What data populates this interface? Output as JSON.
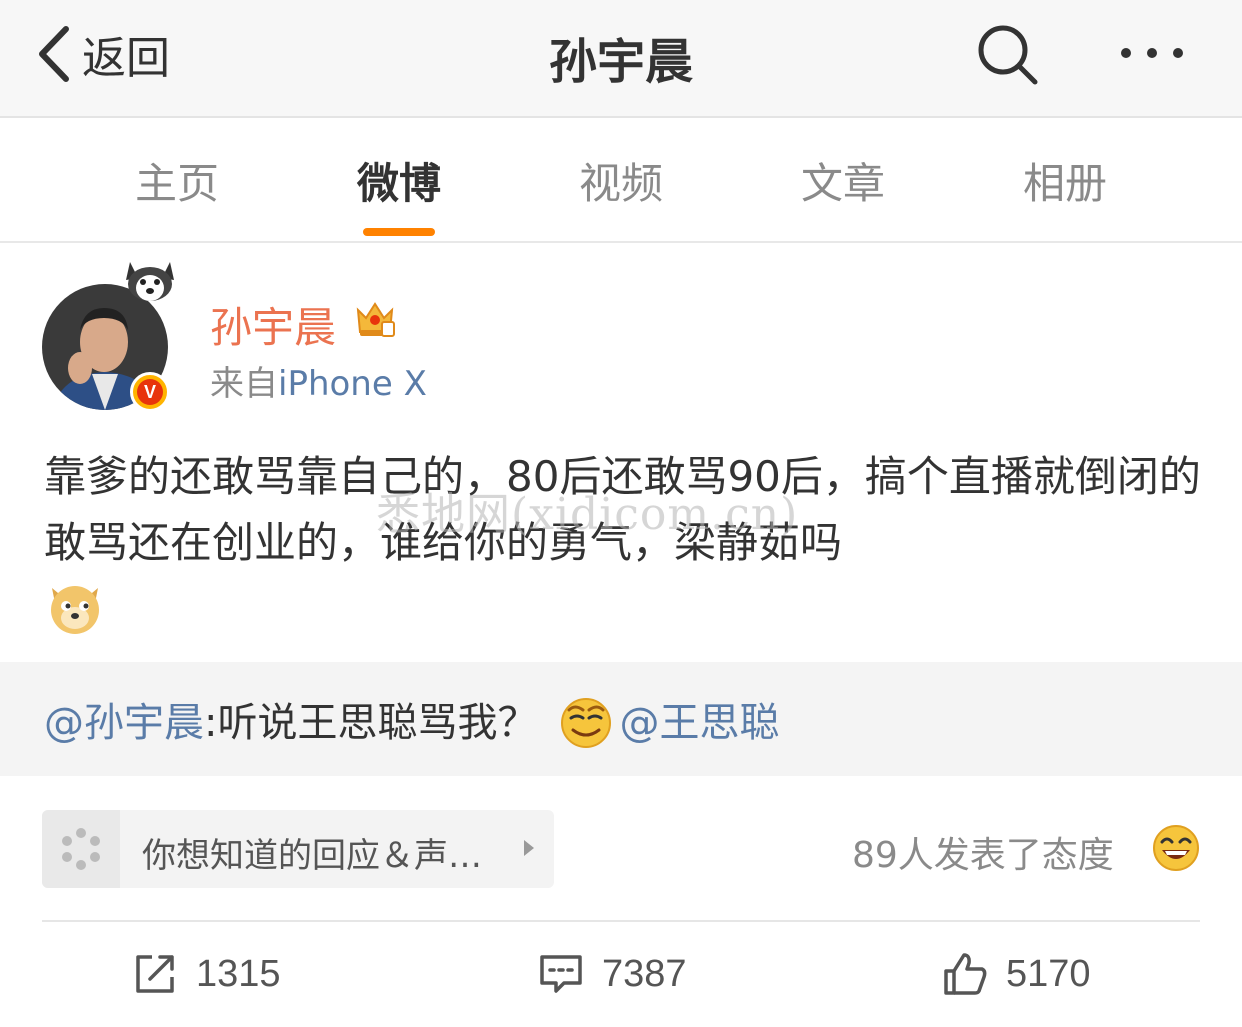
{
  "navbar": {
    "back_label": "返回",
    "title": "孙宇晨",
    "search_icon": "search-icon",
    "more_icon": "more-dots-icon"
  },
  "tabs": [
    {
      "label": "主页",
      "active": false
    },
    {
      "label": "微博",
      "active": true
    },
    {
      "label": "视频",
      "active": false
    },
    {
      "label": "文章",
      "active": false
    },
    {
      "label": "相册",
      "active": false
    }
  ],
  "colors": {
    "accent": "#ff8200",
    "author_name": "#eb7350",
    "link": "#5a7ca8"
  },
  "post": {
    "author": "孙宇晨",
    "source_prefix": "来自",
    "source_device": "iPhone X",
    "text": "靠爹的还敢骂靠自己的，80后还敢骂90后，搞个直播就倒闭的敢骂还在创业的，谁给你的勇气，梁静茹吗",
    "watermark": "悉地网(xidicom.cn)"
  },
  "quote": {
    "mention_author": "@孙宇晨",
    "body": ":听说王思聪骂我？",
    "mention_target": "@王思聪"
  },
  "topic_chip": {
    "label": "你想知道的回应＆声…"
  },
  "attitude": {
    "text": "89人发表了态度"
  },
  "actions": {
    "repost_count": "1315",
    "comment_count": "7387",
    "like_count": "5170"
  }
}
